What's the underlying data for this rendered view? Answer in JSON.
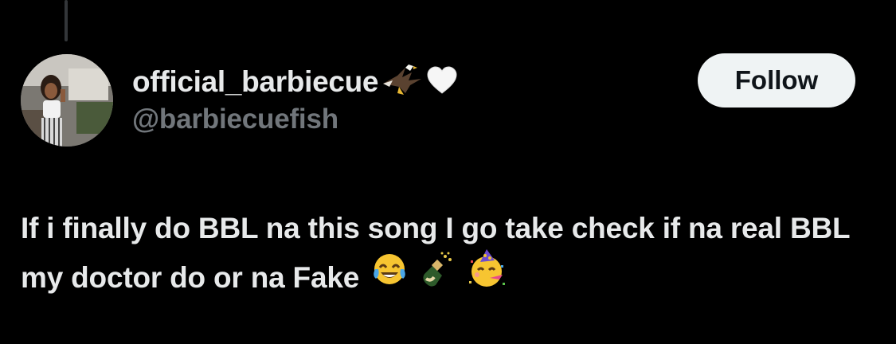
{
  "user": {
    "display_name": "official_barbiecue",
    "handle": "@barbiecuefish",
    "name_emojis": [
      "eagle-icon",
      "white-heart-icon"
    ]
  },
  "follow_button": {
    "label": "Follow"
  },
  "tweet": {
    "text": "If i finally do BBL na this song I go take check if na real BBL my doctor do or na Fake",
    "emojis": [
      "tears-of-joy-emoji-icon",
      "champagne-bottle-icon",
      "partying-face-emoji-icon"
    ]
  },
  "colors": {
    "background": "#000000",
    "primary_text": "#e7e9ea",
    "secondary_text": "#71767b",
    "button_bg": "#eff3f4",
    "button_text": "#0f1419"
  }
}
